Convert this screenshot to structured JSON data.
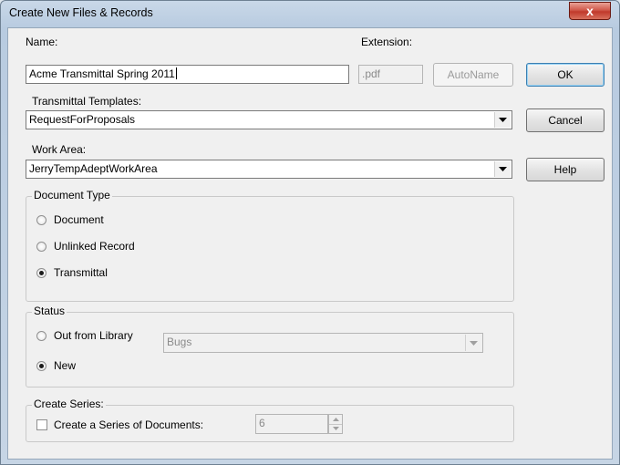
{
  "window": {
    "title": "Create New Files & Records",
    "close_symbol": "x"
  },
  "name": {
    "label": "Name:",
    "value": "Acme Transmittal Spring 2011"
  },
  "extension": {
    "label": "Extension:",
    "value": ".pdf"
  },
  "buttons": {
    "autoname": "AutoName",
    "ok": "OK",
    "cancel": "Cancel",
    "help": "Help"
  },
  "transmittal_templates": {
    "label": "Transmittal Templates:",
    "selected": "RequestForProposals"
  },
  "work_area": {
    "label": "Work Area:",
    "selected": "JerryTempAdeptWorkArea"
  },
  "document_type": {
    "label": "Document Type",
    "options": [
      {
        "label": "Document",
        "checked": false
      },
      {
        "label": "Unlinked Record",
        "checked": false
      },
      {
        "label": "Transmittal",
        "checked": true
      }
    ]
  },
  "status": {
    "label": "Status",
    "options": [
      {
        "label": "Out from Library",
        "checked": false
      },
      {
        "label": "New",
        "checked": true
      }
    ],
    "library_select": "Bugs"
  },
  "create_series": {
    "label": "Create Series:",
    "checkbox_label": "Create a Series of Documents:",
    "checked": false,
    "count": "6"
  }
}
